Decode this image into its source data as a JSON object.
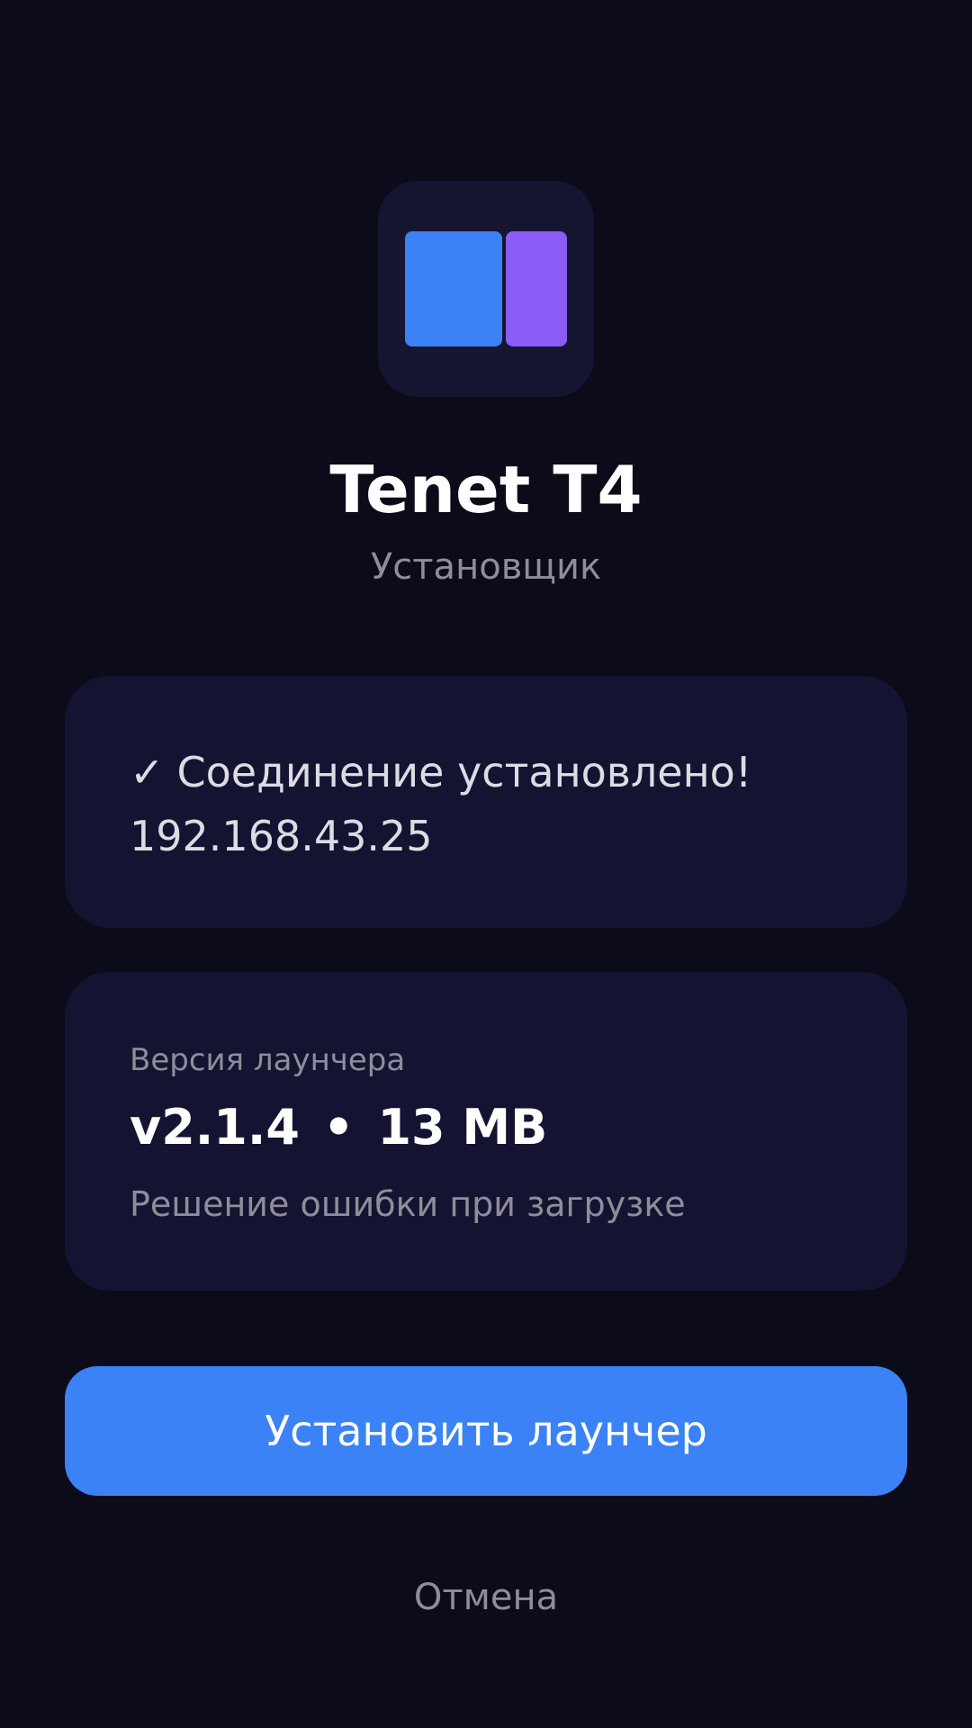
{
  "app": {
    "name": "Tenet T4",
    "subtitle": "Установщик",
    "icon_colors": {
      "left_block": "#3b82f6",
      "right_block": "#8b5cf6",
      "background": "#151532"
    }
  },
  "connection": {
    "check_glyph": "✓",
    "status_text": "Соединение установлено!",
    "ip_address": "192.168.43.25"
  },
  "version_card": {
    "label": "Версия лаунчера",
    "version": "v2.1.4",
    "separator": "•",
    "size": "13 MB",
    "note": "Решение ошибки при загрузке"
  },
  "actions": {
    "install_label": "Установить лаунчер",
    "cancel_label": "Отмена"
  },
  "colors": {
    "background": "#0b0b1a",
    "card": "#141432",
    "accent": "#3b82f6"
  }
}
